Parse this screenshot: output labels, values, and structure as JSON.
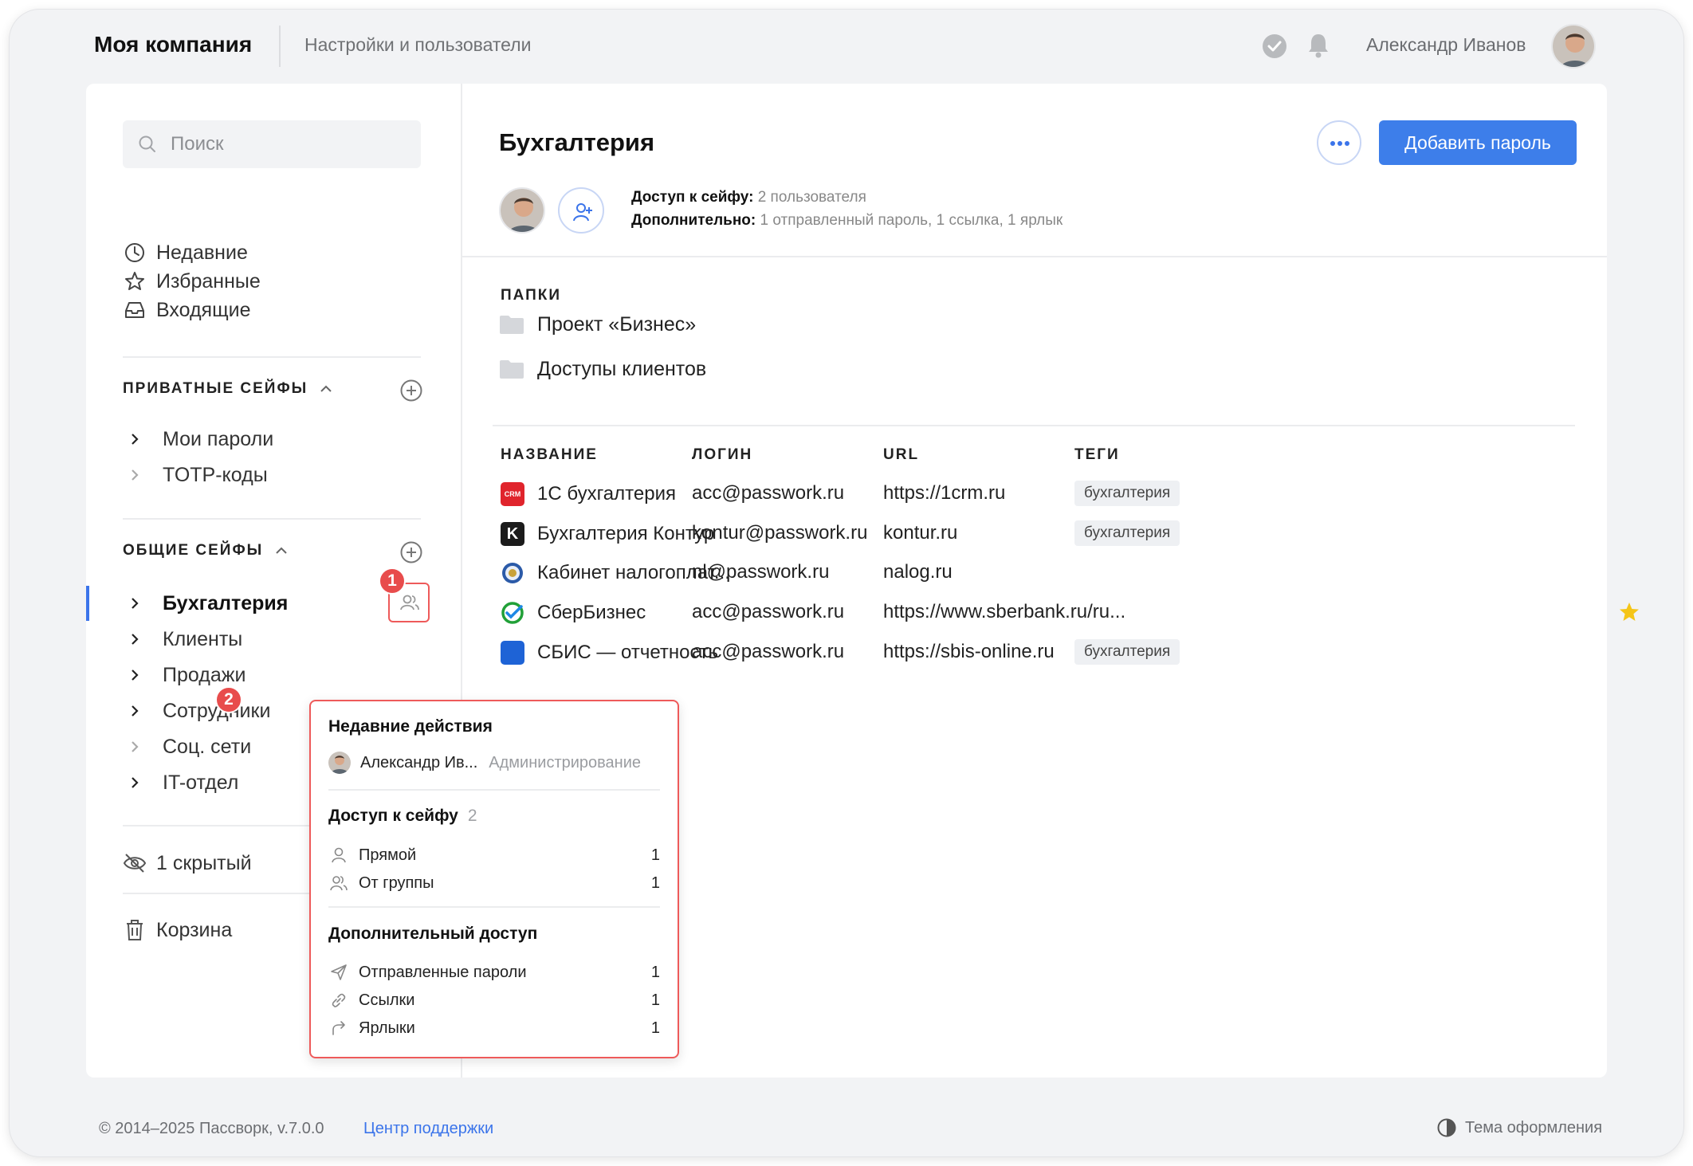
{
  "header": {
    "company": "Моя компания",
    "breadcrumb": "Настройки и пользователи",
    "user_name": "Александр Иванов"
  },
  "sidebar": {
    "search_placeholder": "Поиск",
    "nav": [
      {
        "label": "Недавние",
        "icon": "clock-icon"
      },
      {
        "label": "Избранные",
        "icon": "star-icon"
      },
      {
        "label": "Входящие",
        "icon": "inbox-icon"
      }
    ],
    "private_title": "ПРИВАТНЫЕ СЕЙФЫ",
    "private_vaults": [
      "Мои пароли",
      "TOTP-коды"
    ],
    "shared_title": "ОБЩИЕ СЕЙФЫ",
    "shared_vaults": [
      "Бухгалтерия",
      "Клиенты",
      "Продажи",
      "Сотрудники",
      "Соц. сети",
      "IT-отдел"
    ],
    "hidden_label": "1 скрытый",
    "trash_label": "Корзина",
    "badge_1": "1",
    "badge_2": "2"
  },
  "vault": {
    "title": "Бухгалтерия",
    "add_button": "Добавить пароль",
    "access_label": "Доступ к сейфу:",
    "access_value": "2 пользователя",
    "extra_label": "Дополнительно:",
    "extra_value": "1 отправленный пароль, 1 ссылка, 1 ярлык",
    "folders_title": "ПАПКИ",
    "folders": [
      "Проект «Бизнес»",
      "Доступы клиентов"
    ],
    "columns": {
      "name": "НАЗВАНИЕ",
      "login": "ЛОГИН",
      "url": "URL",
      "tags": "ТЕГИ"
    },
    "rows": [
      {
        "name": "1С бухгалтерия",
        "login": "acc@passwork.ru",
        "url": "https://1crm.ru",
        "tag": "бухгалтерия",
        "icon": "crm-logo-icon",
        "logo_text": "CRM"
      },
      {
        "name": "Бухгалтерия Контур",
        "login": "kontur@passwork.ru",
        "url": "kontur.ru",
        "tag": "бухгалтерия",
        "icon": "kontur-logo-icon",
        "logo_text": "K"
      },
      {
        "name": "Кабинет налогоплат...",
        "login": "nl@passwork.ru",
        "url": "nalog.ru",
        "tag": "",
        "icon": "nalog-logo-icon"
      },
      {
        "name": "СберБизнес",
        "login": "acc@passwork.ru",
        "url": "https://www.sberbank.ru/ru...",
        "tag": "",
        "icon": "sber-logo-icon",
        "favorite": true
      },
      {
        "name": "СБИС — отчетность",
        "login": "acc@passwork.ru",
        "url": "https://sbis-online.ru",
        "tag": "бухгалтерия",
        "icon": "sbis-logo-icon"
      }
    ]
  },
  "popup": {
    "recent_title": "Недавние действия",
    "recent_user": "Александр Ив...",
    "recent_action": "Администрирование",
    "access_title": "Доступ к сейфу",
    "access_count": "2",
    "direct_label": "Прямой",
    "direct_count": "1",
    "group_label": "От группы",
    "group_count": "1",
    "extra_title": "Дополнительный доступ",
    "sent_label": "Отправленные пароли",
    "sent_count": "1",
    "links_label": "Ссылки",
    "links_count": "1",
    "shortcuts_label": "Ярлыки",
    "shortcuts_count": "1"
  },
  "footer": {
    "copyright": "© 2014–2025 Пассворк, v.7.0.0",
    "support": "Центр поддержки",
    "theme": "Тема оформления"
  },
  "colors": {
    "accent": "#3d7eea",
    "highlight": "#ee5a5a",
    "star": "#f5c518"
  }
}
